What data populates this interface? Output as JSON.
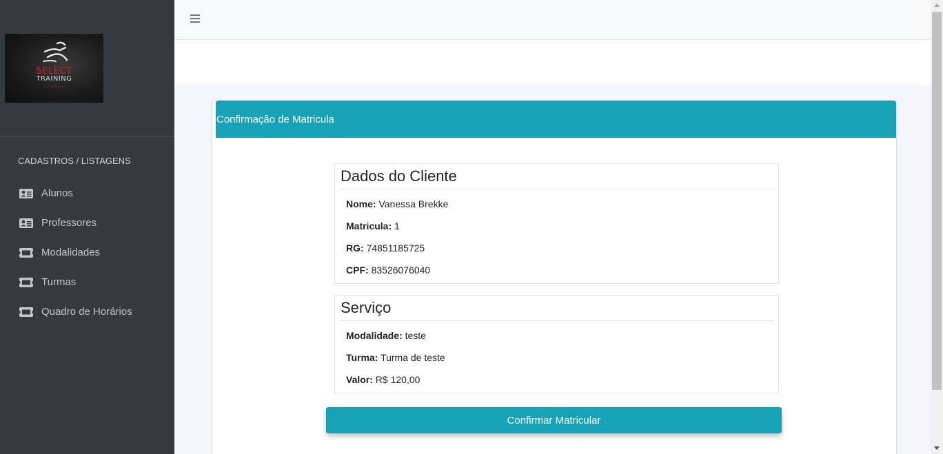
{
  "sidebar": {
    "logo": {
      "line1": "SELECT",
      "line2": "TRAINING",
      "line3": "FITNESS"
    },
    "section_header": "CADASTROS / LISTAGENS",
    "items": [
      {
        "label": "Alunos",
        "icon": "id-card-icon"
      },
      {
        "label": "Professores",
        "icon": "id-card-icon"
      },
      {
        "label": "Modalidades",
        "icon": "ticket-icon"
      },
      {
        "label": "Turmas",
        "icon": "ticket-icon"
      },
      {
        "label": "Quadro de Horários",
        "icon": "ticket-icon"
      }
    ]
  },
  "topbar": {
    "menu_icon": "hamburger-icon"
  },
  "card": {
    "title": "Confirmação de Matricula",
    "cliente": {
      "title": "Dados do Cliente",
      "fields": [
        {
          "label": "Nome:",
          "value": "Vanessa Brekke"
        },
        {
          "label": "Matricula:",
          "value": "1"
        },
        {
          "label": "RG:",
          "value": "74851185725"
        },
        {
          "label": "CPF:",
          "value": "83526076040"
        }
      ]
    },
    "servico": {
      "title": "Serviço",
      "fields": [
        {
          "label": "Modalidade:",
          "value": "teste"
        },
        {
          "label": "Turma:",
          "value": "Turma de teste"
        },
        {
          "label": "Valor:",
          "value": "R$ 120,00"
        }
      ]
    },
    "confirm_label": "Confirmar Matricular"
  },
  "colors": {
    "sidebar_bg": "#343a40",
    "accent": "#17a2b8",
    "brand_red": "#c0262c"
  }
}
